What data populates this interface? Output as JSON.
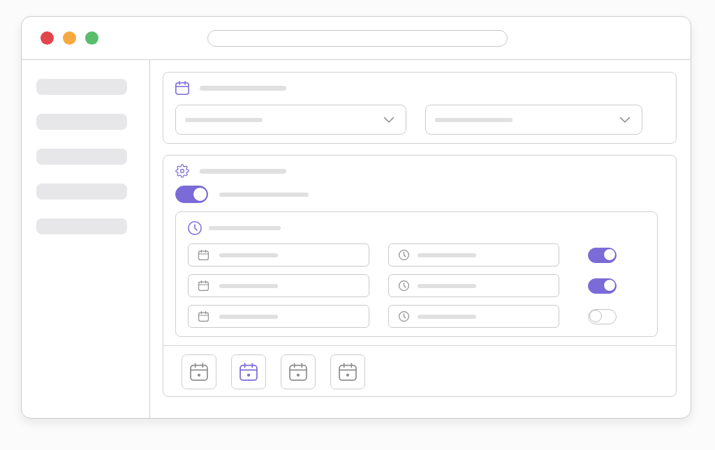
{
  "window": {
    "controls": [
      {
        "color": "#e0464b"
      },
      {
        "color": "#f5a940"
      },
      {
        "color": "#5abd6c"
      }
    ]
  },
  "sidebar": {
    "items": [
      {
        "selected": false
      },
      {
        "selected": false
      },
      {
        "selected": false
      },
      {
        "selected": false
      },
      {
        "selected": false
      }
    ]
  },
  "date_range_card": {
    "dropdowns": [
      {
        "expanded": false
      },
      {
        "expanded": false
      }
    ]
  },
  "settings_card": {
    "master_toggle": {
      "on": true
    },
    "schedule": {
      "rows": [
        {
          "on": true
        },
        {
          "on": true
        },
        {
          "on": false
        }
      ]
    },
    "date_tiles": [
      {
        "selected": false
      },
      {
        "selected": true
      },
      {
        "selected": false
      },
      {
        "selected": false
      }
    ]
  }
}
